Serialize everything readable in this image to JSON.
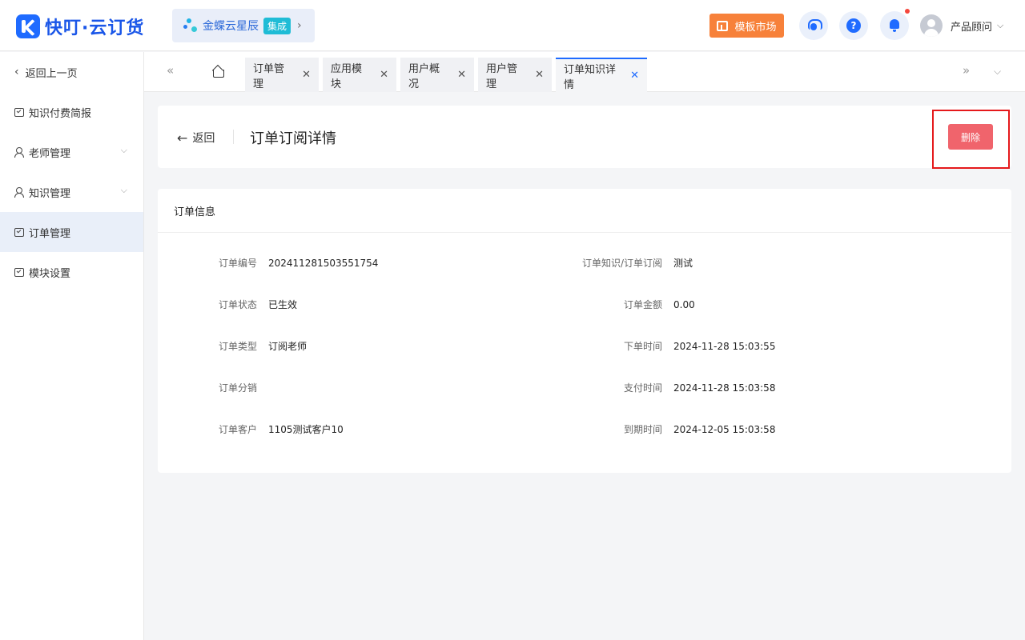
{
  "header": {
    "logo_text": "快叮·云订货",
    "kingdee_name": "金蝶云星辰",
    "kingdee_badge": "集成",
    "template_market": "模板市场",
    "user_name": "产品顾问"
  },
  "sidebar": {
    "items": [
      {
        "label": "返回上一页"
      },
      {
        "label": "知识付费简报"
      },
      {
        "label": "老师管理"
      },
      {
        "label": "知识管理"
      },
      {
        "label": "订单管理"
      },
      {
        "label": "模块设置"
      }
    ]
  },
  "tabs": [
    {
      "label": "订单管理"
    },
    {
      "label": "应用模块"
    },
    {
      "label": "用户概况"
    },
    {
      "label": "用户管理"
    },
    {
      "label": "订单知识详情"
    }
  ],
  "page": {
    "back_label": "返回",
    "title": "订单订阅详情",
    "delete_label": "删除"
  },
  "info": {
    "section_title": "订单信息",
    "left": [
      {
        "label": "订单编号",
        "value": "202411281503551754"
      },
      {
        "label": "订单状态",
        "value": "已生效"
      },
      {
        "label": "订单类型",
        "value": "订阅老师"
      },
      {
        "label": "订单分销",
        "value": ""
      },
      {
        "label": "订单客户",
        "value": "1105测试客户10"
      }
    ],
    "right": [
      {
        "label": "订单知识/订单订阅",
        "value": "测试"
      },
      {
        "label": "订单金额",
        "value": "0.00"
      },
      {
        "label": "下单时间",
        "value": "2024-11-28 15:03:55"
      },
      {
        "label": "支付时间",
        "value": "2024-11-28 15:03:58"
      },
      {
        "label": "到期时间",
        "value": "2024-12-05 15:03:58"
      }
    ]
  },
  "colors": {
    "brand_blue": "#1f6bff",
    "delete_red": "#f0646c",
    "template_orange": "#f7813a"
  }
}
